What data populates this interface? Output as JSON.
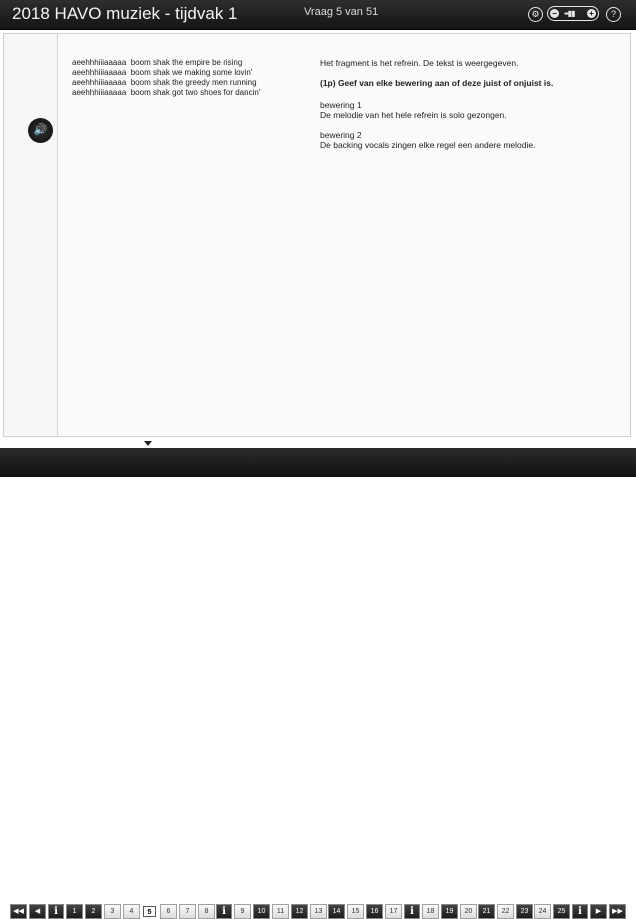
{
  "header": {
    "title": "2018 HAVO muziek - tijdvak 1",
    "question_counter": "Vraag 5 van 51"
  },
  "audio_button_icon": "speaker-icon",
  "lyrics": [
    "aeehhhiiiaaaaa  boom shak the empire be rising",
    "aeehhhiiiaaaaa  boom shak we making some lovin'",
    "aeehhhiiiaaaaa  boom shak the greedy men running",
    "aeehhhiiiaaaaa  boom shak got two shoes for dancin'"
  ],
  "question": {
    "intro": "Het fragment is het refrein. De tekst is weergegeven.",
    "prompt": "(1p) Geef van elke bewering aan of deze juist of onjuist is.",
    "statement1_label": "bewering 1",
    "statement1_text": "De melodie van het hele refrein is solo gezongen.",
    "statement2_label": "bewering 2",
    "statement2_text": "De backing vocals zingen elke regel een andere melodie."
  },
  "nav": {
    "first": "◀◀",
    "prev": "◀",
    "next": "▶",
    "last": "▶▶",
    "info": "i",
    "pages": [
      "1",
      "2",
      "3",
      "4",
      "5",
      "6",
      "7",
      "8",
      "9",
      "10",
      "11",
      "12",
      "13",
      "14",
      "15",
      "16",
      "17",
      "18",
      "19",
      "20",
      "21",
      "22",
      "23",
      "24",
      "25"
    ],
    "current_page": "5"
  }
}
